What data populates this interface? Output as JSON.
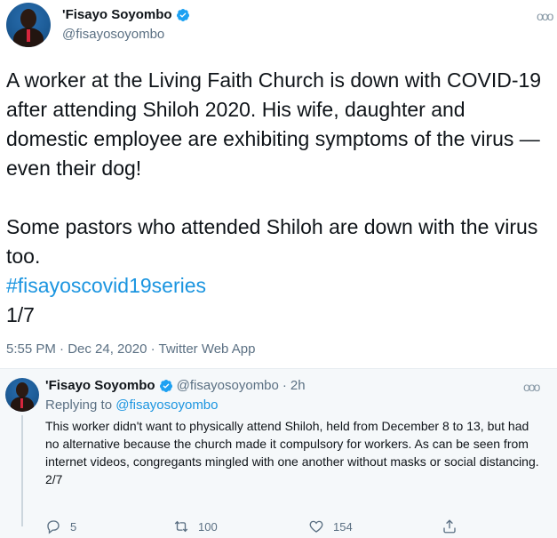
{
  "main_tweet": {
    "display_name": "'Fisayo Soyombo",
    "handle": "@fisayosoyombo",
    "more_icon": "ooo",
    "paragraph1": "A worker at the Living Faith Church is down with COVID-19 after attending Shiloh 2020. His wife, daughter and domestic employee are exhibiting symptoms of the virus — even their dog!",
    "paragraph2": "Some pastors who attended Shiloh are down with the virus too.",
    "hashtag": "#fisayoscovid19series",
    "counter": "1/7",
    "meta": "5:55 PM · Dec 24, 2020 · Twitter Web App"
  },
  "reply_tweet": {
    "display_name": "'Fisayo Soyombo",
    "handle": "@fisayosoyombo",
    "separator": "·",
    "time": "2h",
    "more_icon": "ooo",
    "replying_prefix": "Replying to",
    "replying_handle": "@fisayosoyombo",
    "text": "This worker didn't want to physically attend Shiloh, held from December 8 to 13, but had no alternative because the church made it compulsory for workers. As can be seen from internet videos, congregants mingled with one another without masks or social distancing.",
    "counter": "2/7",
    "actions": {
      "reply_count": "5",
      "retweet_count": "100",
      "like_count": "154"
    }
  },
  "colors": {
    "link": "#1b95e0",
    "secondary_text": "#5b7083",
    "verified": "#1da1f2",
    "reply_bg": "#f5f8fa"
  },
  "icons": [
    "verified-badge-icon",
    "more-icon",
    "reply-icon",
    "retweet-icon",
    "like-icon",
    "share-icon"
  ]
}
